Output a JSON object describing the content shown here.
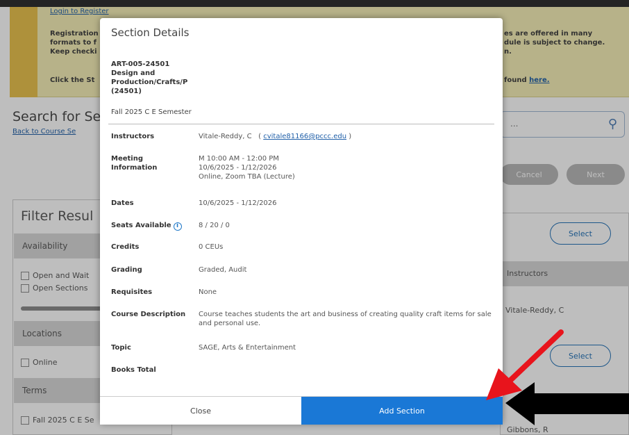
{
  "banner": {
    "login_link": "Login to Register",
    "line1_left": "Registration",
    "line1_right": "es are offered in many",
    "line2_left": "formats to f",
    "line2_right": "dule is subject to change.",
    "line3_left": "Keep checki",
    "line3_right": "n.",
    "line4_left": "Click the St",
    "line4_right": "found",
    "here_link": "here."
  },
  "search": {
    "title": "Search for Se",
    "back_link": "Back to Course Se",
    "placeholder": "..."
  },
  "nav_buttons": {
    "cancel": "Cancel",
    "next": "Next"
  },
  "filter": {
    "title": "Filter Resul",
    "availability": "Availability",
    "opt_open_wait": "Open and Wait",
    "opt_open_sections": "Open Sections",
    "locations": "Locations",
    "opt_online": "Online",
    "terms": "Terms",
    "opt_fall": "Fall 2025 C E Se"
  },
  "results": {
    "select_label": "Select",
    "instructors_header": "Instructors",
    "instructor_1": "Vitale-Reddy, C",
    "instructor_2": "Gibbons, R"
  },
  "modal": {
    "title": "Section Details",
    "course_code": "ART-005-24501",
    "course_name": "Design and Production/Crafts/P (24501)",
    "term": "Fall 2025 C E Semester",
    "rows": {
      "instructors_label": "Instructors",
      "instructors_value": "Vitale-Reddy, C",
      "instructors_email": "cvitale81166@pccc.edu",
      "meeting_label": "Meeting Information",
      "meeting_line1": "M 10:00 AM - 12:00 PM",
      "meeting_line2": "10/6/2025 - 1/12/2026",
      "meeting_line3": "Online, Zoom TBA (Lecture)",
      "dates_label": "Dates",
      "dates_value": "10/6/2025 - 1/12/2026",
      "seats_label": "Seats Available",
      "seats_value": "8 / 20 / 0",
      "credits_label": "Credits",
      "credits_value": "0 CEUs",
      "grading_label": "Grading",
      "grading_value": "Graded, Audit",
      "requisites_label": "Requisites",
      "requisites_value": "None",
      "description_label": "Course Description",
      "description_value": "Course teaches students the art and business of creating quality craft items for sale and personal use.",
      "topic_label": "Topic",
      "topic_value": "SAGE, Arts & Entertainment",
      "books_label": "Books Total"
    },
    "close_label": "Close",
    "add_label": "Add Section"
  },
  "colors": {
    "primary_blue": "#1a78d6",
    "red_arrow": "#e8141c",
    "black_arrow": "#000000"
  }
}
